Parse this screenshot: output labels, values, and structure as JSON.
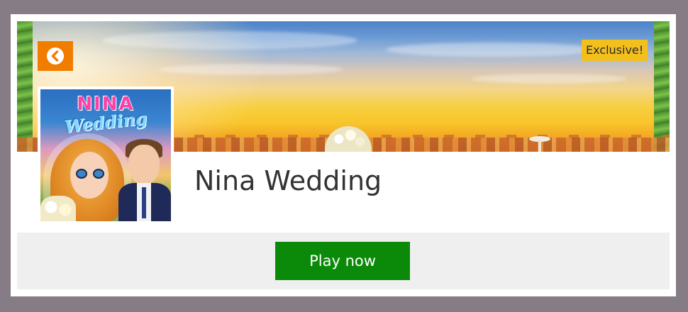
{
  "game": {
    "title": "Nina Wedding",
    "badge": "Exclusive!",
    "thumbnail": {
      "title_line1": "NINA",
      "title_line2": "Wedding"
    }
  },
  "actions": {
    "back_icon": "chevron-left-icon",
    "play_label": "Play now"
  },
  "colors": {
    "page_background": "#857c86",
    "card_background": "#ffffff",
    "back_button": "#f07d00",
    "badge": "#f3bf1d",
    "play_button": "#0a8a08",
    "play_bar": "#efefef",
    "title_text": "#333333"
  }
}
